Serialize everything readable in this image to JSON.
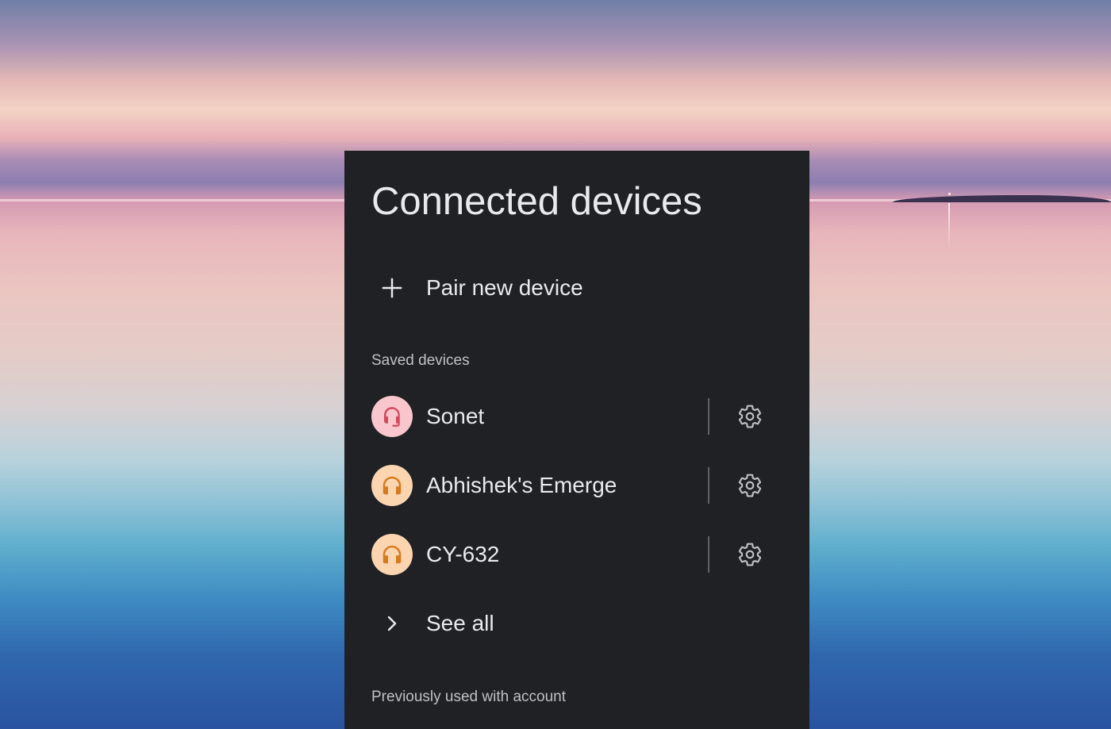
{
  "panel": {
    "title": "Connected devices",
    "pair_label": "Pair new device",
    "saved_header": "Saved devices",
    "devices": [
      {
        "name": "Sonet",
        "icon": "headset-mic-icon",
        "avatar_bg": "#f8c6cc",
        "icon_color": "#d14a5a"
      },
      {
        "name": "Abhishek's Emerge",
        "icon": "headphones-icon",
        "avatar_bg": "#fbd4b0",
        "icon_color": "#d57b1f"
      },
      {
        "name": "CY-632",
        "icon": "headphones-icon",
        "avatar_bg": "#fbd4b0",
        "icon_color": "#d57b1f"
      }
    ],
    "see_all_label": "See all",
    "previous_header": "Previously used with account"
  },
  "colors": {
    "panel_bg": "#202124",
    "text_primary": "#e8eaed",
    "text_secondary": "#bdc1c6",
    "divider": "#5f6368"
  }
}
